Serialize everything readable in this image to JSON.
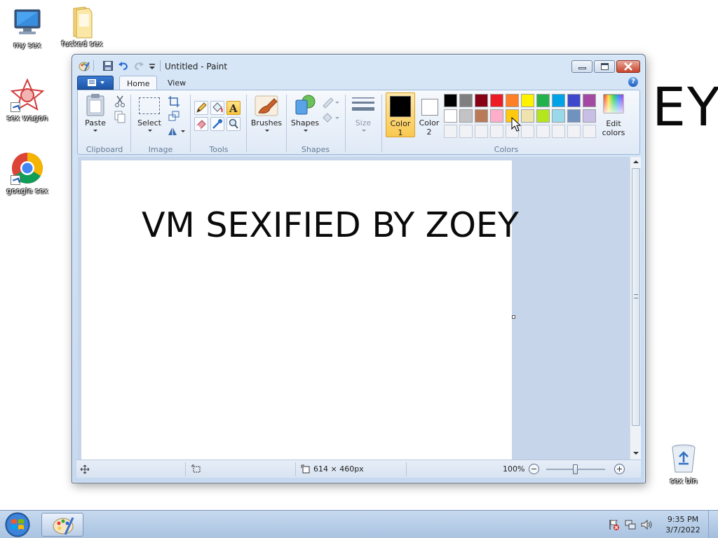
{
  "desktop": {
    "background_text": "EY",
    "icons": [
      {
        "label": "my sex",
        "icon": "computer-icon"
      },
      {
        "label": "fucked sex",
        "icon": "folder-icon"
      },
      {
        "label": "sex wagon",
        "icon": "wagon-app-icon"
      },
      {
        "label": "google sex",
        "icon": "chrome-icon"
      },
      {
        "label": "sex bin",
        "icon": "recycle-bin-icon"
      }
    ]
  },
  "window": {
    "title": "Untitled - Paint",
    "tabs": [
      {
        "label": "Home",
        "active": true
      },
      {
        "label": "View",
        "active": false
      }
    ],
    "ribbon": {
      "groups": {
        "clipboard": "Clipboard",
        "image": "Image",
        "tools": "Tools",
        "shapes": "Shapes",
        "colors": "Colors"
      },
      "buttons": {
        "paste": "Paste",
        "select": "Select",
        "brushes": "Brushes",
        "shapes": "Shapes",
        "size": "Size",
        "color1_line1": "Color",
        "color1_line2": "1",
        "color2_line1": "Color",
        "color2_line2": "2",
        "edit_colors_line1": "Edit",
        "edit_colors_line2": "colors"
      },
      "color1": "#000000",
      "color2": "#ffffff",
      "palette_row1": [
        "#000000",
        "#7f7f7f",
        "#880015",
        "#ed1c24",
        "#ff7f27",
        "#fff200",
        "#22b14c",
        "#00a2e8",
        "#3f48cc",
        "#a349a4"
      ],
      "palette_row2": [
        "#ffffff",
        "#c3c3c3",
        "#b97a57",
        "#ffaec9",
        "#ffc90e",
        "#efe4b0",
        "#b5e61d",
        "#99d9ea",
        "#7092be",
        "#c8bfe7"
      ]
    },
    "canvas": {
      "text": "VM SEXIFIED BY ZOEY"
    },
    "status": {
      "dimensions": "614 × 460px",
      "zoom": "100%"
    }
  },
  "taskbar": {
    "time": "9:35 PM",
    "date": "3/7/2022"
  }
}
